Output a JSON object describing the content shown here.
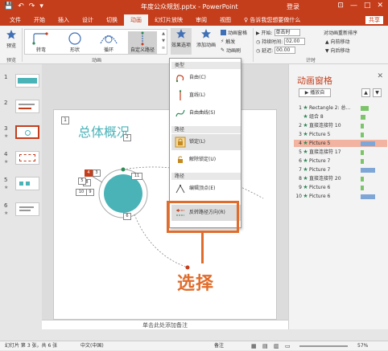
{
  "titlebar": {
    "title": "年度公众规划.pptx - PowerPoint",
    "user": "登录",
    "qa_save": "💾",
    "qa_undo": "↶",
    "qa_redo": "↷",
    "qa_more": "▾",
    "win_min": "—",
    "win_max": "□",
    "win_close": "✕",
    "win_opt": "⊡"
  },
  "tabs": {
    "items": [
      "文件",
      "开始",
      "插入",
      "设计",
      "切换",
      "动画",
      "幻灯片放映",
      "审阅",
      "视图"
    ],
    "active_index": 5,
    "tellme": "♀ 告诉我您想要做什么",
    "share": "共享"
  },
  "ribbon": {
    "preview": "预览",
    "effects": [
      "转弯",
      "形状",
      "循环",
      "自定义路径"
    ],
    "effect_options": "效果选项",
    "add_animation": "添加动画",
    "animation_pane": "动画窗格",
    "trigger": "触发",
    "painter": "动画刷",
    "start_label": "▶ 开始:",
    "start_value": "单击时",
    "duration_label": "◷ 持续时间:",
    "duration_value": "02.00",
    "delay_label": "◷ 延迟:",
    "delay_value": "00.00",
    "reorder": "对动画重新排序",
    "move_earlier": "▲ 向前移动",
    "move_later": "▼ 向后移动",
    "group_preview": "预览",
    "group_animation": "动画",
    "group_timing": "计时"
  },
  "dropdown": {
    "section_type": "类型",
    "unlocked_item": "自由(C)",
    "straight_item": "直线(L)",
    "curve_item": "自由曲线(S)",
    "section_origin": "路径",
    "locked_item": "锁定(L)",
    "unlock_item": "解除锁定(U)",
    "section_path": "路径",
    "edit_points": "编辑顶点(E)",
    "reverse_path": "反转路径方向(R)"
  },
  "callout_label": "选择",
  "slide": {
    "title": "总体概况",
    "number_box": "1",
    "tags": [
      "2",
      "4",
      "3",
      "8",
      "10",
      "9",
      "6",
      "5",
      "11"
    ]
  },
  "thumbs": {
    "numbers": [
      "1",
      "2",
      "3",
      "4",
      "5",
      "6"
    ],
    "selected_index": 2
  },
  "anim_pane": {
    "title": "动画窗格",
    "close": "✕",
    "play": "▶ 播放自",
    "up": "▲",
    "down": "▼",
    "items": [
      {
        "num": "1",
        "label": "Rectangle 2: 总...",
        "bar_color": "#7cc46a",
        "bar_w": 10
      },
      {
        "num": "",
        "label": "组合 8",
        "bar_color": "#7cc46a",
        "bar_w": 6
      },
      {
        "num": "2",
        "label": "直接连接符 10",
        "bar_color": "#7cc46a",
        "bar_w": 4
      },
      {
        "num": "3",
        "label": "Picture 5",
        "bar_color": "#7cc46a",
        "bar_w": 4
      },
      {
        "num": "4",
        "label": "Picture 5",
        "bar_color": "#7ea6d6",
        "bar_w": 18
      },
      {
        "num": "5",
        "label": "直接连接符 17",
        "bar_color": "#7cc46a",
        "bar_w": 4
      },
      {
        "num": "6",
        "label": "Picture 7",
        "bar_color": "#7cc46a",
        "bar_w": 4
      },
      {
        "num": "7",
        "label": "Picture 7",
        "bar_color": "#7ea6d6",
        "bar_w": 18
      },
      {
        "num": "8",
        "label": "直接连接符 20",
        "bar_color": "#7cc46a",
        "bar_w": 4
      },
      {
        "num": "9",
        "label": "Picture 6",
        "bar_color": "#7cc46a",
        "bar_w": 4
      },
      {
        "num": "10",
        "label": "Picture 6",
        "bar_color": "#7ea6d6",
        "bar_w": 18
      }
    ]
  },
  "notes_text": "单击此处添加备注",
  "status": {
    "left": "幻灯片 第 3 张，共 6 张",
    "lang": "中文(中国)",
    "notes": "备注",
    "zoom": "57%"
  }
}
